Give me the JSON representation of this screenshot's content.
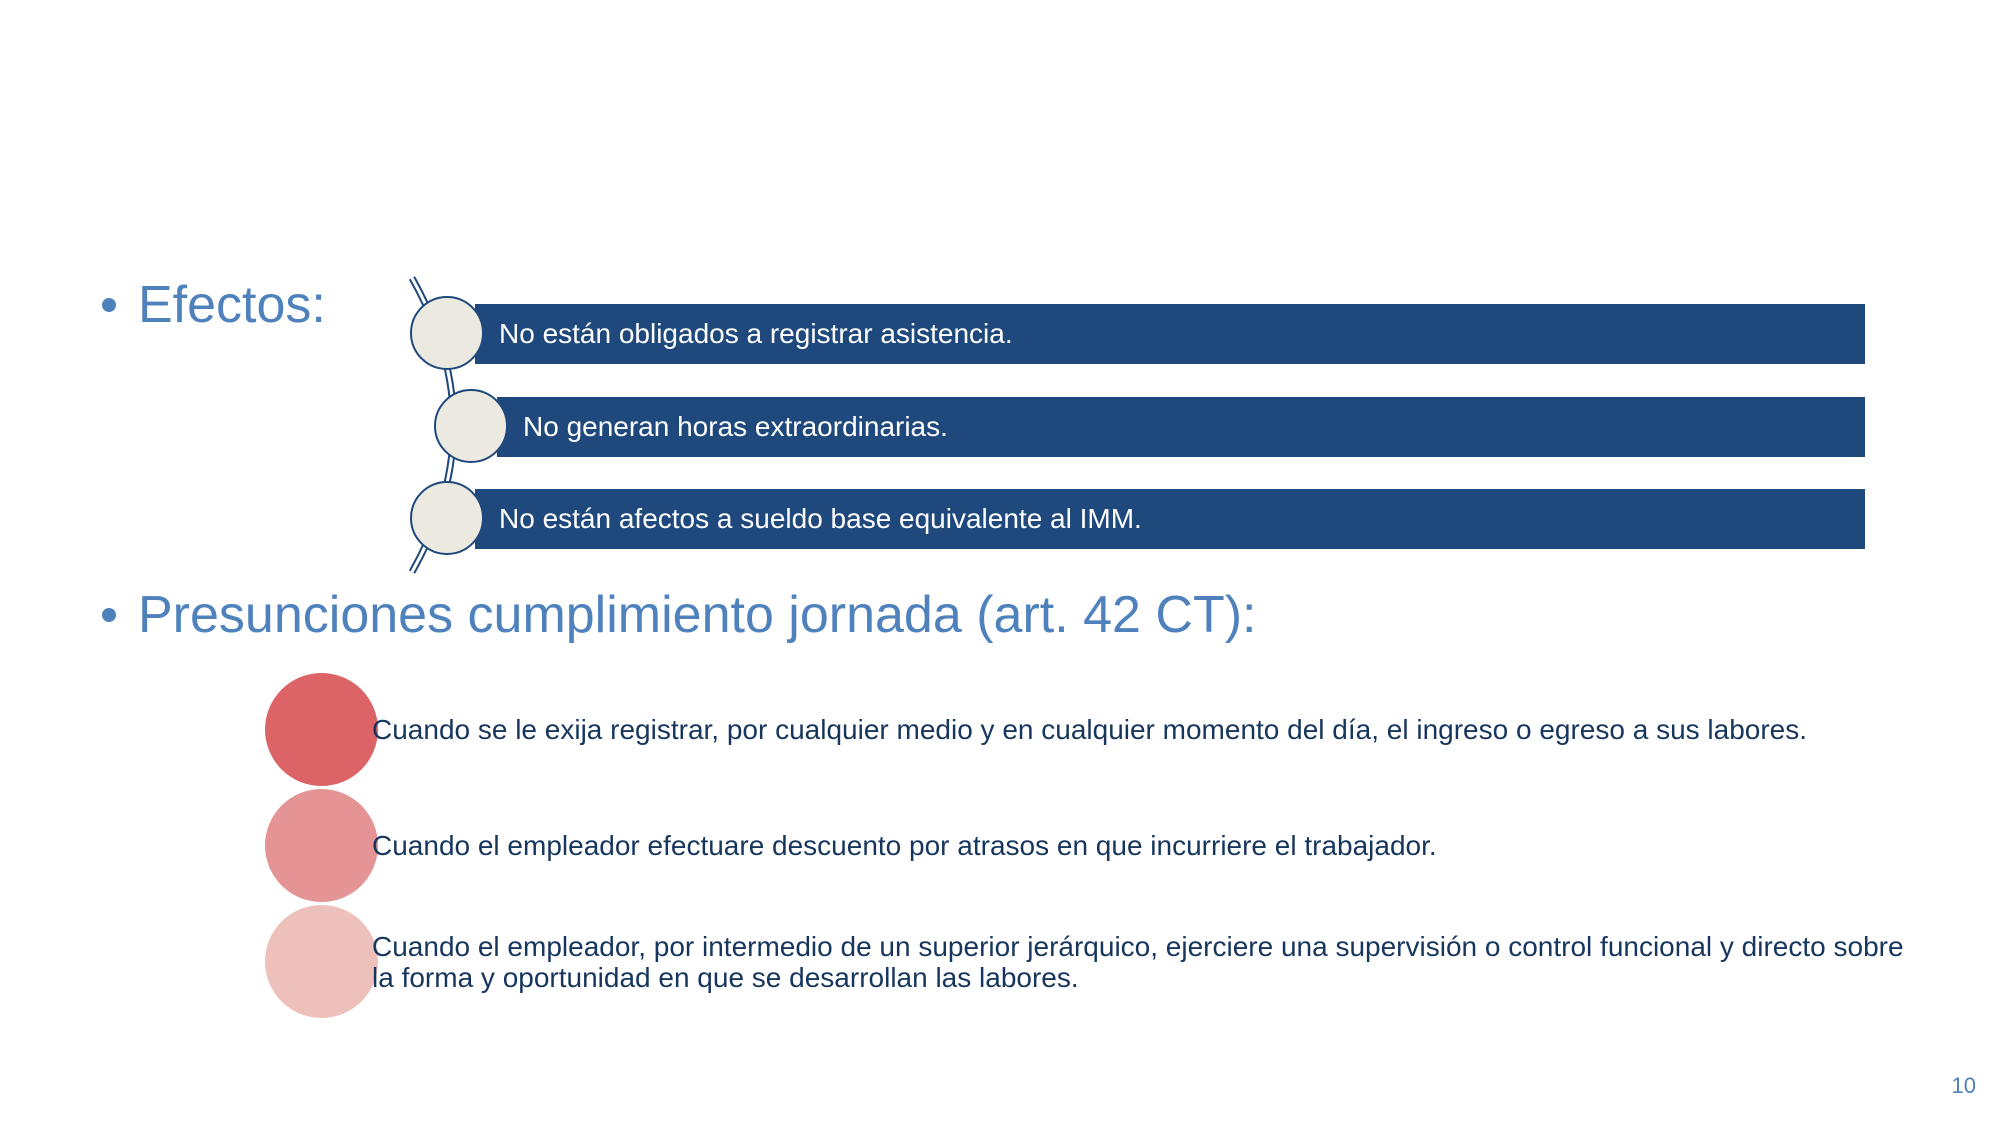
{
  "slide": {
    "page_number": "10",
    "colors": {
      "heading": "#4f81bd",
      "bar": "#1f497d",
      "circle_fill": "#ece9e1",
      "presuncion_1": "#dc6366",
      "presuncion_2": "#e49494",
      "presuncion_3": "#edc0bb",
      "body_text": "#17365d"
    }
  },
  "efectos": {
    "heading": "Efectos:",
    "items": [
      {
        "text": "No están obligados a registrar asistencia."
      },
      {
        "text": "No generan horas extraordinarias."
      },
      {
        "text": "No están afectos a sueldo base equivalente al IMM."
      }
    ]
  },
  "presunciones": {
    "heading": "Presunciones cumplimiento jornada (art. 42 CT):",
    "items": [
      {
        "text": "Cuando se le exija registrar, por cualquier medio y en cualquier momento del día, el ingreso o egreso a sus labores.",
        "color": "#dc6366"
      },
      {
        "text": "Cuando el empleador efectuare descuento por atrasos en que incurriere el trabajador.",
        "color": "#e49494"
      },
      {
        "text": "Cuando el empleador, por intermedio de un superior jerárquico, ejerciere una supervisión o control funcional y directo sobre la forma y oportunidad en que se desarrollan las labores.",
        "color": "#edc0bb"
      }
    ]
  }
}
